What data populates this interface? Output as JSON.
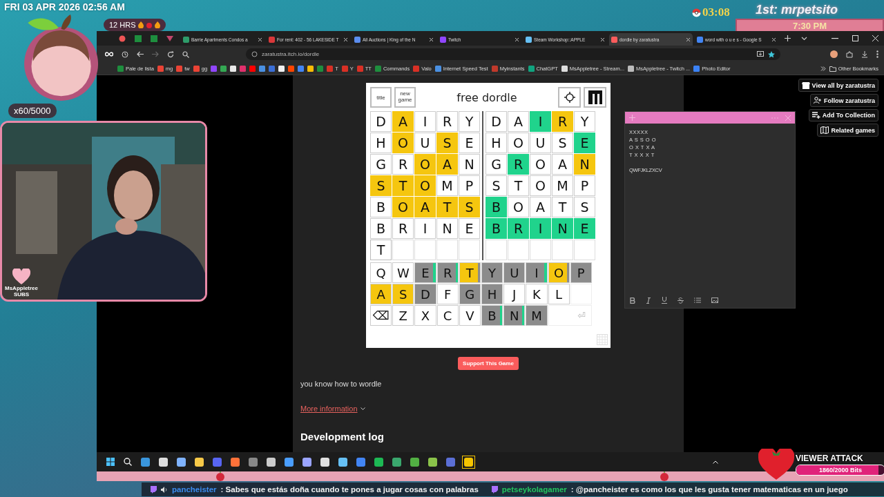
{
  "overlay": {
    "datetime": "FRI 03 APR 2026 02:56 AM",
    "hours_badge": "12 HRS",
    "counter": "x60/5000",
    "timer": "03:08",
    "leader": "1st: mrpetsito",
    "clock_sign": "7:30 PM",
    "webcam_label": "MsAppletree",
    "webcam_sublabel": "SUBS",
    "viewer_attack": {
      "title": "VIEWER ATTACK",
      "reading": "1860/2000 Bits",
      "level": 0.93
    }
  },
  "browser": {
    "tabs": [
      {
        "title": "Barrie Apartments Condos a",
        "color": "#2e9c6a",
        "selected": false
      },
      {
        "title": "For rent: 402 - 56 LAKESIDE T",
        "color": "#d9383a",
        "selected": false
      },
      {
        "title": "All Auctions | King of the N",
        "color": "#5b8def",
        "selected": false
      },
      {
        "title": "Twitch",
        "color": "#9146ff",
        "selected": false
      },
      {
        "title": "Steam Workshop::APPLE",
        "color": "#66c0f4",
        "selected": false
      },
      {
        "title": "dordle by zaratustra",
        "color": "#fa5c5c",
        "selected": true
      },
      {
        "title": "word with o u e s - Google S",
        "color": "#4285f4",
        "selected": false
      }
    ],
    "address": "zaratustra.itch.io/dordle",
    "bookmarks": [
      {
        "label": "Pale de lista",
        "color": "#1e8e3e"
      },
      {
        "label": "mg",
        "color": "#ea4335"
      },
      {
        "label": "tw",
        "color": "#ea4335"
      },
      {
        "label": "gg",
        "color": "#ea4335"
      },
      {
        "color": "#9146ff"
      },
      {
        "color": "#34a853"
      },
      {
        "color": "#e8e8e8"
      },
      {
        "color": "#e1306c"
      },
      {
        "color": "#ff0000"
      },
      {
        "color": "#4a90e2"
      },
      {
        "color": "#3b6fd6"
      },
      {
        "color": "#f0f0f0"
      },
      {
        "color": "#ff4500"
      },
      {
        "color": "#4285f4"
      },
      {
        "color": "#fbbc05"
      },
      {
        "color": "#1e8e3e"
      },
      {
        "label": "T",
        "color": "#d93025"
      },
      {
        "label": "Y",
        "color": "#d93025"
      },
      {
        "label": "TT",
        "color": "#d93025"
      },
      {
        "label": "Commands",
        "color": "#1e8e3e"
      },
      {
        "label": "Valo",
        "color": "#d93025"
      },
      {
        "label": "Internet Speed Test",
        "color": "#4a90e2"
      },
      {
        "label": "Myinstants",
        "color": "#c0392b"
      },
      {
        "label": "ChatGPT",
        "color": "#10a37f"
      },
      {
        "label": "MsAppletree - Stream...",
        "color": "#dddddd"
      },
      {
        "label": "MsAppletree - Twitch ...",
        "color": "#bbbbbb"
      },
      {
        "label": "Photo Editor",
        "color": "#3b82f6"
      }
    ],
    "other_bookmarks": "Other Bookmarks"
  },
  "game": {
    "title": "free dordle",
    "title_button": "title",
    "new_game_button": [
      "new",
      "game"
    ],
    "boards": [
      {
        "rows": [
          [
            {
              "letter": "D",
              "kind": "absent"
            },
            {
              "letter": "A",
              "kind": "present"
            },
            {
              "letter": "I",
              "kind": "absent"
            },
            {
              "letter": "R",
              "kind": "absent"
            },
            {
              "letter": "Y",
              "kind": "absent"
            }
          ],
          [
            {
              "letter": "H",
              "kind": "absent"
            },
            {
              "letter": "O",
              "kind": "present"
            },
            {
              "letter": "U",
              "kind": "absent"
            },
            {
              "letter": "S",
              "kind": "present"
            },
            {
              "letter": "E",
              "kind": "absent"
            }
          ],
          [
            {
              "letter": "G",
              "kind": "absent"
            },
            {
              "letter": "R",
              "kind": "absent"
            },
            {
              "letter": "O",
              "kind": "present"
            },
            {
              "letter": "A",
              "kind": "present"
            },
            {
              "letter": "N",
              "kind": "absent"
            }
          ],
          [
            {
              "letter": "S",
              "kind": "present"
            },
            {
              "letter": "T",
              "kind": "present"
            },
            {
              "letter": "O",
              "kind": "present"
            },
            {
              "letter": "M",
              "kind": "absent"
            },
            {
              "letter": "P",
              "kind": "absent"
            }
          ],
          [
            {
              "letter": "B",
              "kind": "absent"
            },
            {
              "letter": "O",
              "kind": "present"
            },
            {
              "letter": "A",
              "kind": "present"
            },
            {
              "letter": "T",
              "kind": "present"
            },
            {
              "letter": "S",
              "kind": "present"
            }
          ],
          [
            {
              "letter": "B",
              "kind": "absent"
            },
            {
              "letter": "R",
              "kind": "absent"
            },
            {
              "letter": "I",
              "kind": "absent"
            },
            {
              "letter": "N",
              "kind": "absent"
            },
            {
              "letter": "E",
              "kind": "absent"
            }
          ],
          [
            {
              "letter": "T",
              "kind": "typed"
            },
            {
              "kind": "empty"
            },
            {
              "kind": "empty"
            },
            {
              "kind": "empty"
            },
            {
              "kind": "empty"
            }
          ]
        ]
      },
      {
        "rows": [
          [
            {
              "letter": "D",
              "kind": "absent"
            },
            {
              "letter": "A",
              "kind": "absent"
            },
            {
              "letter": "I",
              "kind": "correct"
            },
            {
              "letter": "R",
              "kind": "present"
            },
            {
              "letter": "Y",
              "kind": "absent"
            }
          ],
          [
            {
              "letter": "H",
              "kind": "absent"
            },
            {
              "letter": "O",
              "kind": "absent"
            },
            {
              "letter": "U",
              "kind": "absent"
            },
            {
              "letter": "S",
              "kind": "absent"
            },
            {
              "letter": "E",
              "kind": "correct"
            }
          ],
          [
            {
              "letter": "G",
              "kind": "absent"
            },
            {
              "letter": "R",
              "kind": "correct"
            },
            {
              "letter": "O",
              "kind": "absent"
            },
            {
              "letter": "A",
              "kind": "absent"
            },
            {
              "letter": "N",
              "kind": "present"
            }
          ],
          [
            {
              "letter": "S",
              "kind": "absent"
            },
            {
              "letter": "T",
              "kind": "absent"
            },
            {
              "letter": "O",
              "kind": "absent"
            },
            {
              "letter": "M",
              "kind": "absent"
            },
            {
              "letter": "P",
              "kind": "absent"
            }
          ],
          [
            {
              "letter": "B",
              "kind": "correct"
            },
            {
              "letter": "O",
              "kind": "absent"
            },
            {
              "letter": "A",
              "kind": "absent"
            },
            {
              "letter": "T",
              "kind": "absent"
            },
            {
              "letter": "S",
              "kind": "absent"
            }
          ],
          [
            {
              "letter": "B",
              "kind": "correct"
            },
            {
              "letter": "R",
              "kind": "correct"
            },
            {
              "letter": "I",
              "kind": "correct"
            },
            {
              "letter": "N",
              "kind": "correct"
            },
            {
              "letter": "E",
              "kind": "correct"
            }
          ],
          [
            {
              "kind": "empty"
            },
            {
              "kind": "empty"
            },
            {
              "kind": "empty"
            },
            {
              "kind": "empty"
            },
            {
              "kind": "empty"
            }
          ]
        ]
      }
    ],
    "keyboard": [
      [
        {
          "label": "Q",
          "kind": "plain"
        },
        {
          "label": "W",
          "kind": "plain"
        },
        {
          "label": "E",
          "kind": "split"
        },
        {
          "label": "R",
          "kind": "split"
        },
        {
          "label": "T",
          "kind": "found"
        },
        {
          "label": "Y",
          "kind": "used"
        },
        {
          "label": "U",
          "kind": "used"
        },
        {
          "label": "I",
          "kind": "split"
        },
        {
          "label": "O",
          "kind": "found"
        },
        {
          "label": "P",
          "kind": "used"
        }
      ],
      [
        {
          "label": "A",
          "kind": "present"
        },
        {
          "label": "S",
          "kind": "present"
        },
        {
          "label": "D",
          "kind": "used"
        },
        {
          "label": "F",
          "kind": "plain"
        },
        {
          "label": "G",
          "kind": "used"
        },
        {
          "label": "H",
          "kind": "used"
        },
        {
          "label": "J",
          "kind": "plain"
        },
        {
          "label": "K",
          "kind": "plain"
        },
        {
          "label": "L",
          "kind": "plain"
        }
      ],
      [
        {
          "label": "⌫",
          "kind": "backspace"
        },
        {
          "label": "Z",
          "kind": "plain"
        },
        {
          "label": "X",
          "kind": "plain"
        },
        {
          "label": "C",
          "kind": "plain"
        },
        {
          "label": "V",
          "kind": "plain"
        },
        {
          "label": "B",
          "kind": "split"
        },
        {
          "label": "N",
          "kind": "split"
        },
        {
          "label": "M",
          "kind": "used"
        },
        {
          "label": "⏎",
          "kind": "enter"
        }
      ]
    ]
  },
  "page": {
    "support_button": "Support This Game",
    "description": "you know how to wordle",
    "more_link": "More information",
    "devlog_heading": "Development log",
    "side_buttons": [
      "View all by zaratustra",
      "Follow zaratustra",
      "Add To Collection",
      "Related games"
    ]
  },
  "notes": {
    "lines": [
      "XXXXX",
      "A S S O O",
      "O X T X A",
      "T X X X T"
    ],
    "draft": "QWFJKLZXCV"
  },
  "ticker": [
    {
      "user": "pancheister",
      "color": "#3b8cf0",
      "text": ": Sabes que estás doña cuando te pones a jugar cosas con palabras"
    },
    {
      "user": "petseykolagamer",
      "color": "#22c55e",
      "text": ": @pancheister es como los que les gusta tener matematicas en un juego"
    }
  ]
}
